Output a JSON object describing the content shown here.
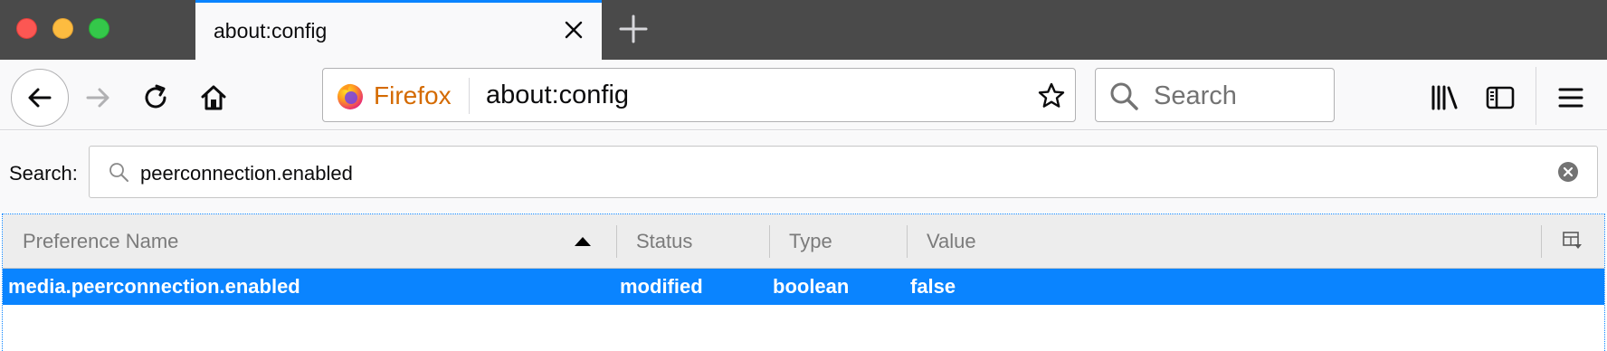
{
  "window": {
    "tab_title": "about:config"
  },
  "navbar": {
    "identity_label": "Firefox",
    "url": "about:config",
    "search_placeholder": "Search"
  },
  "config": {
    "search_label": "Search:",
    "filter_value": "peerconnection.enabled",
    "columns": [
      {
        "label": "Preference Name",
        "sorted": "ascending"
      },
      {
        "label": "Status"
      },
      {
        "label": "Type"
      },
      {
        "label": "Value"
      }
    ],
    "rows": [
      {
        "name": "media.peerconnection.enabled",
        "status": "modified",
        "type": "boolean",
        "value": "false",
        "selected": true
      }
    ]
  },
  "colors": {
    "selection": "#0a84ff",
    "firefox_brand": "#d46a00",
    "tabbar": "#4a4a4a"
  },
  "icons": [
    "close-icon",
    "plus-icon",
    "back-arrow-icon",
    "forward-arrow-icon",
    "reload-icon",
    "home-icon",
    "firefox-logo-icon",
    "star-icon",
    "search-icon",
    "library-icon",
    "sidebar-icon",
    "hamburger-menu-icon",
    "clear-icon",
    "column-picker-icon"
  ]
}
